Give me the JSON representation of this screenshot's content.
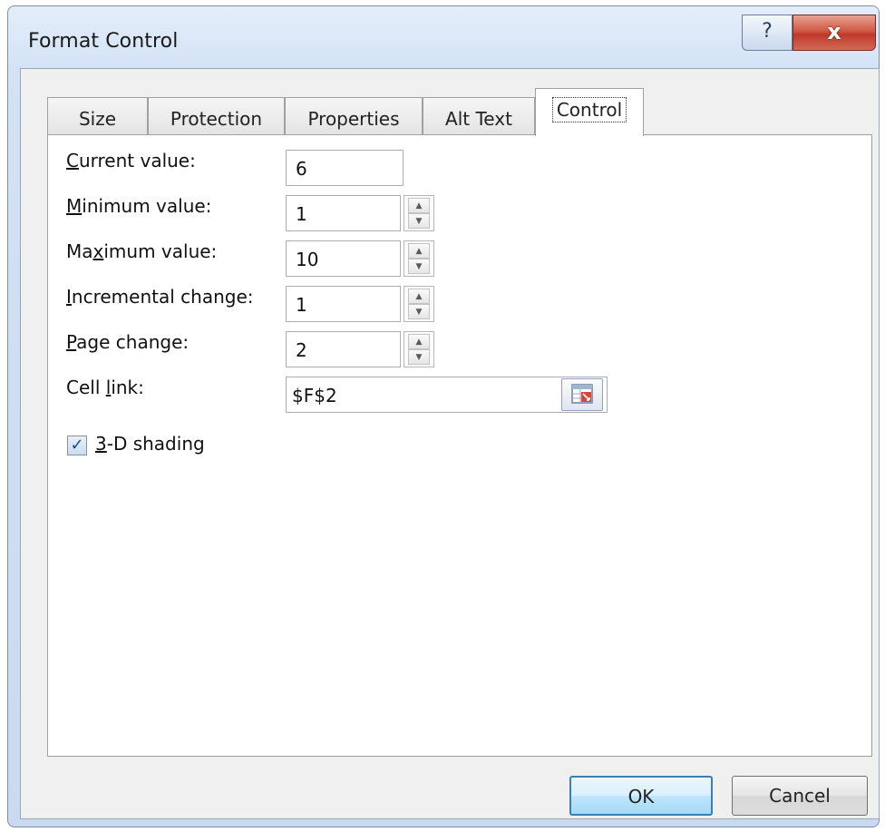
{
  "window": {
    "title": "Format Control",
    "help_glyph": "?",
    "close_glyph": "x"
  },
  "tabs": [
    {
      "label": "Size",
      "active": false
    },
    {
      "label": "Protection",
      "active": false
    },
    {
      "label": "Properties",
      "active": false
    },
    {
      "label": "Alt Text",
      "active": false
    },
    {
      "label": "Control",
      "active": true
    }
  ],
  "form": {
    "current_value": {
      "label_mnemonic": "C",
      "label_rest": "urrent value:",
      "value": "6"
    },
    "minimum_value": {
      "label_mnemonic": "M",
      "label_rest": "inimum value:",
      "value": "1"
    },
    "maximum_value": {
      "label_pre": "Ma",
      "label_mnemonic": "x",
      "label_rest": "imum value:",
      "value": "10"
    },
    "incremental_change": {
      "label_mnemonic": "I",
      "label_rest": "ncremental change:",
      "value": "1"
    },
    "page_change": {
      "label_mnemonic": "P",
      "label_rest": "age change:",
      "value": "2"
    },
    "cell_link": {
      "label_pre": "Cell ",
      "label_mnemonic": "l",
      "label_rest": "ink:",
      "value": "$F$2"
    },
    "shading": {
      "label_mnemonic": "3",
      "label_rest": "-D shading",
      "checked": true,
      "check_glyph": "✓"
    }
  },
  "spinner": {
    "up_glyph": "▲",
    "down_glyph": "▼"
  },
  "buttons": {
    "ok": "OK",
    "cancel": "Cancel"
  }
}
